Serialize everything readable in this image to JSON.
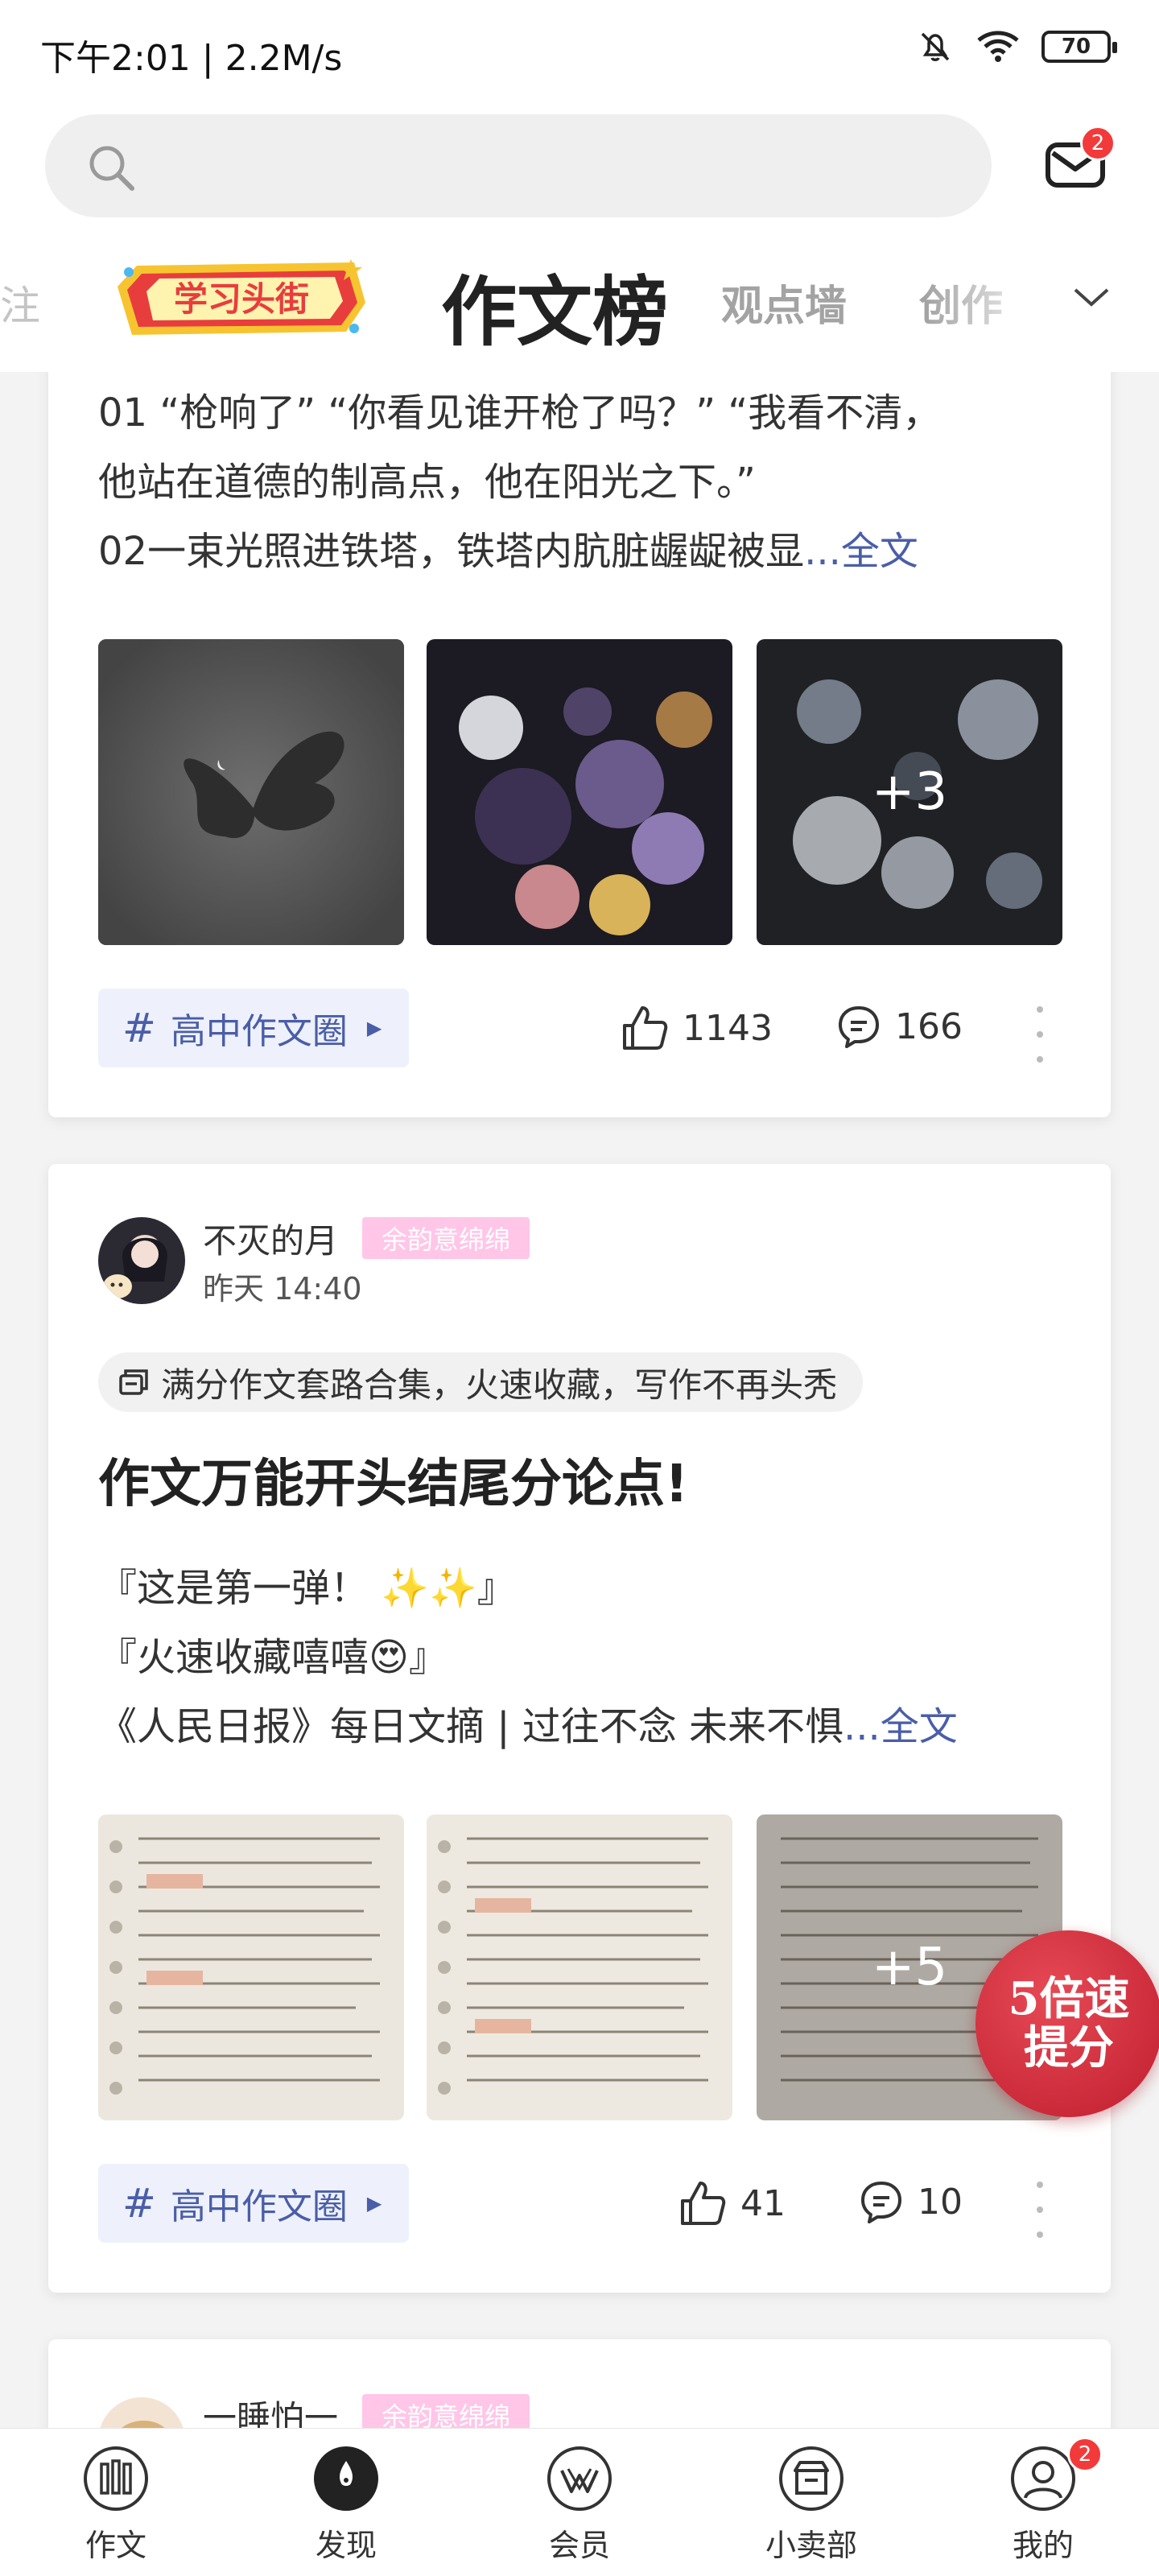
{
  "status_bar": {
    "time": "下午2:01 | 2.2M/s",
    "battery": "70"
  },
  "header": {
    "mail_badge": "2"
  },
  "tabs": {
    "fragment": "注",
    "logo_text": "学习头街",
    "active": "作文榜",
    "items": [
      "观点墙",
      "创作"
    ]
  },
  "posts": [
    {
      "excerpt": [
        "01 “枪响了” “你看见谁开枪了吗？” “我看不清，",
        "他站在道德的制高点，他在阳光之下。”",
        "02一束光照进铁塔，铁塔内肮脏龌龊被显"
      ],
      "full_text_link": "...全文",
      "more_images": "+3",
      "topic": "高中作文圈",
      "likes": "1143",
      "comments": "166"
    },
    {
      "author": "不灭的月",
      "author_tag": "余韵意绵绵",
      "time": "昨天 14:40",
      "collection": "满分作文套路合集，火速收藏，写作不再头秃",
      "title": "作文万能开头结尾分论点!",
      "excerpt": [
        "『这是第一弹！ ✨✨』",
        "『火速收藏嘻嘻😍』",
        "《人民日报》每日文摘 | 过往不念 未来不惧"
      ],
      "full_text_link": "...全文",
      "more_images": "+5",
      "topic": "高中作文圈",
      "likes": "41",
      "comments": "10"
    },
    {
      "author": "一睡怕一",
      "author_tag": "余韵意绵绵"
    }
  ],
  "promo": {
    "line1": "5倍速",
    "line2": "提分"
  },
  "bottom_nav": {
    "items": [
      {
        "label": "作文",
        "icon": "essay-icon"
      },
      {
        "label": "发现",
        "icon": "discover-icon"
      },
      {
        "label": "会员",
        "icon": "vip-icon"
      },
      {
        "label": "小卖部",
        "icon": "shop-icon"
      },
      {
        "label": "我的",
        "icon": "profile-icon"
      }
    ],
    "profile_badge": "2"
  },
  "colors": {
    "accent": "#4a5ea8",
    "tag_pink": "#ffc6e8",
    "badge_red": "#f23a3a",
    "promo_red": "#c01d2e"
  }
}
